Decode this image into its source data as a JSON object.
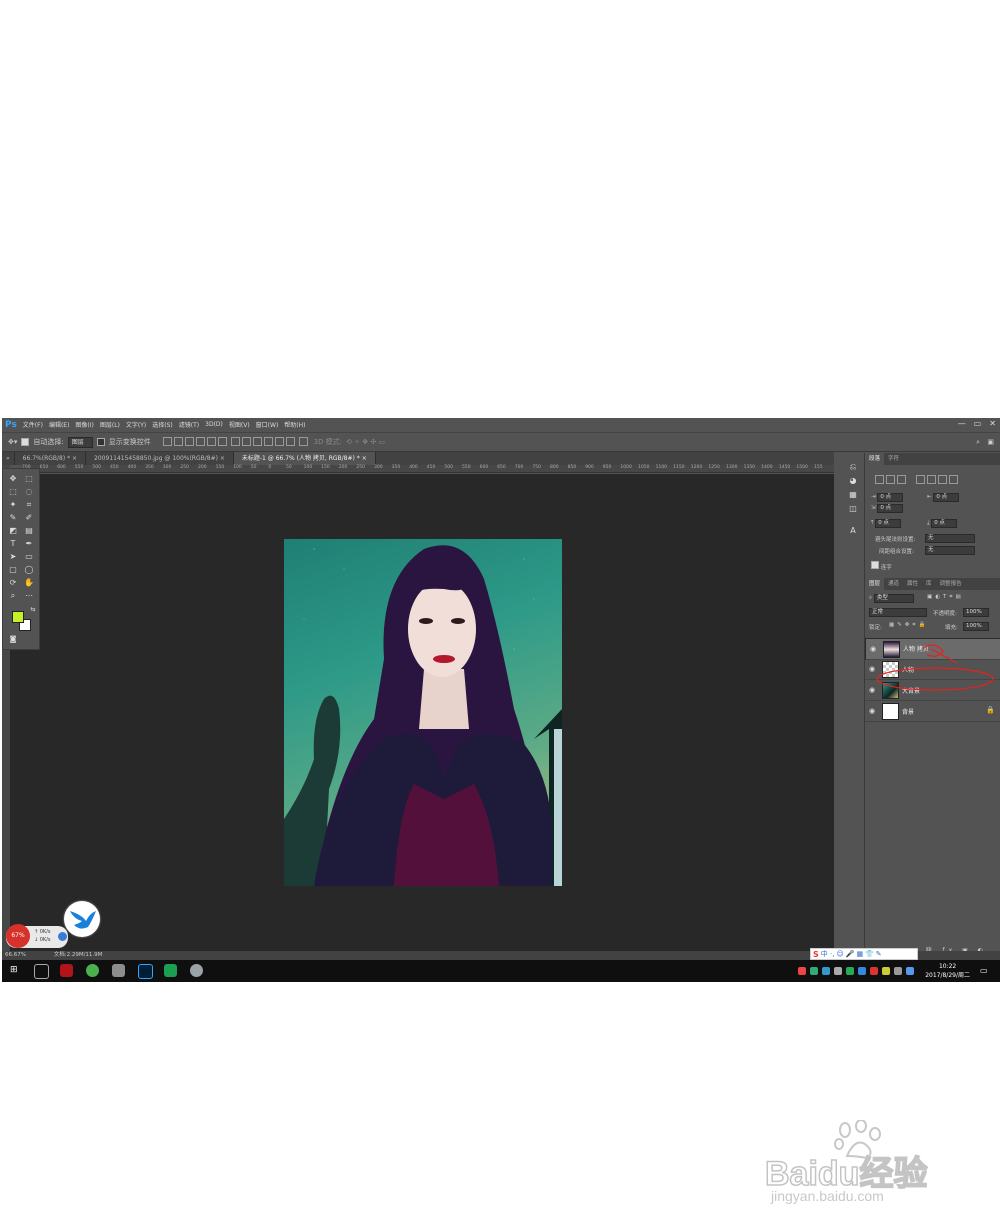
{
  "app": {
    "logo": "Ps",
    "title_controls": [
      "—",
      "▭",
      "✕"
    ]
  },
  "menu": [
    "文件(F)",
    "编辑(E)",
    "图像(I)",
    "图层(L)",
    "文字(Y)",
    "选择(S)",
    "滤镜(T)",
    "3D(D)",
    "视图(V)",
    "窗口(W)",
    "帮助(H)"
  ],
  "options": {
    "auto_select_label": "自动选择:",
    "auto_select_value": "图层",
    "show_transform_label": "显示变换控件",
    "mode3d_label": "3D 模式:"
  },
  "tabs": [
    "66.7%(RGB/8) *",
    "200911415458850.jpg @ 100%(RGB/8#)",
    "未标题-1 @ 66.7% (人物 拷贝, RGB/8#) *"
  ],
  "ruler_ticks": [
    "700",
    "650",
    "600",
    "550",
    "500",
    "450",
    "400",
    "350",
    "300",
    "250",
    "200",
    "150",
    "100",
    "50",
    "0",
    "50",
    "100",
    "150",
    "200",
    "250",
    "300",
    "350",
    "400",
    "450",
    "500",
    "550",
    "600",
    "650",
    "700",
    "750",
    "800",
    "850",
    "900",
    "950",
    "1000",
    "1050",
    "1100",
    "1150",
    "1200",
    "1250",
    "1300",
    "1350",
    "1400",
    "1450",
    "1500",
    "155"
  ],
  "paragraph_panel": {
    "tabs": [
      "段落",
      "字符"
    ],
    "fields": [
      "0 点",
      "0 点",
      "0 点",
      "0 点",
      "0 点"
    ],
    "kinsoku_label": "避头尾法则设置:",
    "kinsoku_value": "无",
    "spacing_label": "间距组合设置:",
    "spacing_value": "无",
    "hyphen_label": "连字"
  },
  "layers_panel": {
    "tabs": [
      "图层",
      "通道",
      "属性",
      "库",
      "调整报告"
    ],
    "filter": "类型",
    "blend_mode": "正常",
    "opacity_label": "不透明度:",
    "opacity_value": "100%",
    "lock_label": "锁定:",
    "fill_label": "填充:",
    "fill_value": "100%",
    "layers": [
      {
        "name": "人物 拷贝",
        "selected": true
      },
      {
        "name": "人物",
        "selected": false
      },
      {
        "name": "大背景",
        "selected": false
      },
      {
        "name": "背景",
        "selected": false,
        "locked": true
      }
    ]
  },
  "statusbar": {
    "zoom": "66.67%",
    "doc": "文档:2.29M/11.9M"
  },
  "netwidget": {
    "percent": "67%",
    "up": "0K/s",
    "down": "0K/s"
  },
  "taskbar": {
    "time": "10:22",
    "date": "2017/8/29/周二"
  },
  "watermark": {
    "brand": "Baidu经验",
    "url": "jingyan.baidu.com"
  },
  "colors": {
    "foreground": "#c6f02a",
    "background": "#ffffff",
    "annotation": "#e8201e"
  }
}
